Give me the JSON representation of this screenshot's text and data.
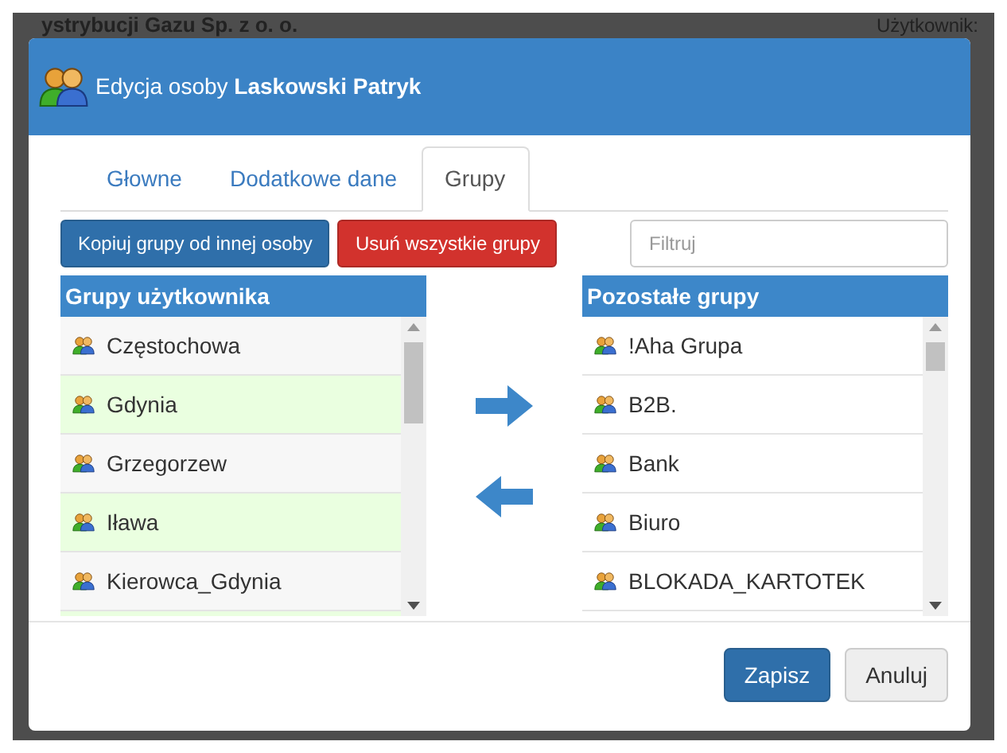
{
  "page_behind": {
    "title": "ystrybucji Gazu Sp. z o. o.",
    "user_label": "Użytkownik:"
  },
  "dialog": {
    "title": "Edycja osoby **Laskowski Patryk**"
  },
  "tabs": [
    {
      "label": "Głowne",
      "selected": false
    },
    {
      "label": "Dodatkowe dane",
      "selected": false
    },
    {
      "label": "Grupy",
      "selected": true
    }
  ],
  "actions": {
    "copy_button": "Kopiuj grupy od innej osoby",
    "remove_button": "Usuń wszystkie grupy",
    "filter": {
      "placeholder": "Filtruj"
    }
  },
  "user_groups": {
    "title": "Grupy użytkownika",
    "items": [
      "Częstochowa",
      "Gdynia",
      "Grzegorzew",
      "Iława",
      "Kierowca_Gdynia"
    ]
  },
  "other_groups": {
    "title": "Pozostałe grupy",
    "items": [
      "!Aha Grupa",
      "B2B.",
      "Bank",
      "Biuro",
      "BLOKADA_KARTOTEK"
    ]
  },
  "footer": {
    "save": "Zapisz",
    "cancel": "Anuluj"
  }
}
